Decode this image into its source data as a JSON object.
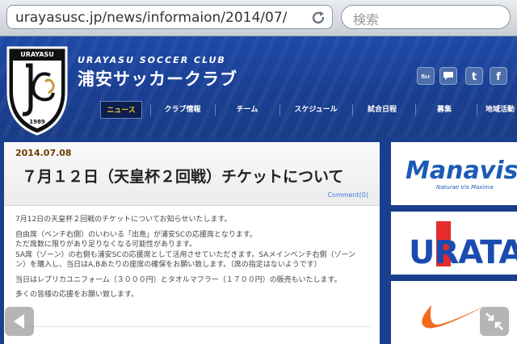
{
  "browser": {
    "url": "urayasusc.jp/news/informaion/2014/07/",
    "search_placeholder": "検索"
  },
  "header": {
    "club_name_en": "URAYASU SOCCER CLUB",
    "club_name_ja": "浦安サッカークラブ",
    "emblem_top": "URAYASU",
    "emblem_year": "1989",
    "social": [
      "flickr-icon",
      "chat-icon",
      "twitter-icon",
      "facebook-icon"
    ],
    "nav": [
      "ニュース",
      "クラブ情報",
      "チーム",
      "スケジュール",
      "試合日程",
      "募集",
      "地域活動"
    ],
    "nav_active_index": 0
  },
  "article": {
    "date": "2014.07.08",
    "title": "７月１２日（天皇杯２回戦）チケットについて",
    "comment_link": "Comment(0)",
    "paragraphs": [
      [
        "7月12日の天皇杯２回戦のチケットについてお知らせいたします。"
      ],
      [
        "自由席（ベンチ右側）のいわいる「出島」が浦安SCの応援席となります。",
        "ただ席数に限りがあり足りなくなる可能性があります。",
        "SA席（ゾーン）の右側も浦安SCの応援席として活用させていただきます。SAメインベンチ右側（ゾーン",
        "ン）を購入し、当日はA,Bあたりの座席の確保をお願い致します。（席の指定はないようです）"
      ],
      [
        "当日はレプリカユニフォーム（３０００円）とタオルマフラー（１７００円）の販売もいたします。"
      ],
      [
        "多くの皆様の応援をお願い致します。"
      ]
    ]
  },
  "sidebar": {
    "banner1": {
      "logo": "Manavis",
      "tagline": "Naturae Vis Maxima"
    },
    "banner2": {
      "logo": "URATA"
    },
    "banner3": {
      "logo": "nike-swoosh-icon"
    }
  },
  "colors": {
    "header_blue": "#1e4aa6",
    "nav_active_text": "#f1c233",
    "date_text": "#6a3c00",
    "link": "#3d7ad6",
    "manavis_blue": "#1c5bb5",
    "urata_blue": "#1a4bb0",
    "urata_red": "#e52b2b",
    "nike_orange": "#f26b1d"
  }
}
